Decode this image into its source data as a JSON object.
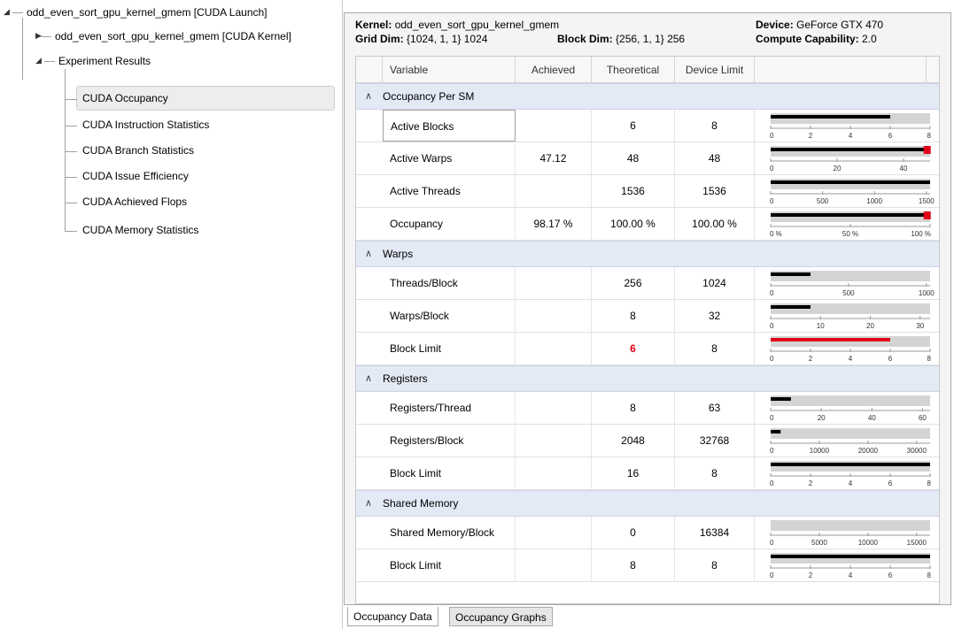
{
  "tree": {
    "root": "odd_even_sort_gpu_kernel_gmem [CUDA Launch]",
    "kernel_node": "odd_even_sort_gpu_kernel_gmem [CUDA Kernel]",
    "results_node": "Experiment Results",
    "children": [
      "CUDA Occupancy",
      "CUDA Instruction Statistics",
      "CUDA Branch Statistics",
      "CUDA Issue Efficiency",
      "CUDA Achieved Flops",
      "CUDA Memory Statistics"
    ],
    "selected": "CUDA Occupancy"
  },
  "header": {
    "kernel_label": "Kernel:",
    "kernel_value": "odd_even_sort_gpu_kernel_gmem",
    "grid_label": "Grid Dim:",
    "grid_value": "{1024, 1, 1} 1024",
    "block_label": "Block Dim:",
    "block_value": "{256, 1, 1} 256",
    "device_label": "Device:",
    "device_value": "GeForce GTX 470",
    "cc_label": "Compute Capability:",
    "cc_value": "2.0"
  },
  "columns": [
    "Variable",
    "Achieved",
    "Theoretical",
    "Device Limit"
  ],
  "sections": [
    {
      "title": "Occupancy Per SM",
      "rows": [
        {
          "name": "Active Blocks",
          "achieved": "",
          "theoretical": "6",
          "limit": "8",
          "bar": {
            "max": 8,
            "value": 6,
            "ticks": [
              "0",
              "2",
              "4",
              "6",
              "8"
            ],
            "tickvals": [
              0,
              2,
              4,
              6,
              8
            ],
            "marker": null,
            "color": "#000000"
          }
        },
        {
          "name": "Active Warps",
          "achieved": "47.12",
          "theoretical": "48",
          "limit": "48",
          "bar": {
            "max": 48,
            "value": 48,
            "ticks": [
              "0",
              "20",
              "40"
            ],
            "tickvals": [
              0,
              20,
              40
            ],
            "marker": 47.12,
            "color": "#000000"
          }
        },
        {
          "name": "Active Threads",
          "achieved": "",
          "theoretical": "1536",
          "limit": "1536",
          "bar": {
            "max": 1536,
            "value": 1536,
            "ticks": [
              "0",
              "500",
              "1000",
              "1500"
            ],
            "tickvals": [
              0,
              500,
              1000,
              1500
            ],
            "marker": null,
            "color": "#000000"
          }
        },
        {
          "name": "Occupancy",
          "achieved": "98.17 %",
          "theoretical": "100.00 %",
          "limit": "100.00 %",
          "bar": {
            "max": 100,
            "value": 100,
            "ticks": [
              "0 %",
              "50 %",
              "100 %"
            ],
            "tickvals": [
              0,
              50,
              100
            ],
            "marker": 98.17,
            "color": "#000000"
          }
        }
      ]
    },
    {
      "title": "Warps",
      "rows": [
        {
          "name": "Threads/Block",
          "achieved": "",
          "theoretical": "256",
          "limit": "1024",
          "bar": {
            "max": 1024,
            "value": 256,
            "ticks": [
              "0",
              "500",
              "1000"
            ],
            "tickvals": [
              0,
              500,
              1000
            ],
            "marker": null,
            "color": "#000000"
          }
        },
        {
          "name": "Warps/Block",
          "achieved": "",
          "theoretical": "8",
          "limit": "32",
          "bar": {
            "max": 32,
            "value": 8,
            "ticks": [
              "0",
              "10",
              "20",
              "30"
            ],
            "tickvals": [
              0,
              10,
              20,
              30
            ],
            "marker": null,
            "color": "#000000"
          }
        },
        {
          "name": "Block Limit",
          "achieved": "",
          "theoretical": "6",
          "limit": "8",
          "theoretical_highlight": true,
          "bar": {
            "max": 8,
            "value": 6,
            "ticks": [
              "0",
              "2",
              "4",
              "6",
              "8"
            ],
            "tickvals": [
              0,
              2,
              4,
              6,
              8
            ],
            "marker": null,
            "color": "#e0001a"
          }
        }
      ]
    },
    {
      "title": "Registers",
      "rows": [
        {
          "name": "Registers/Thread",
          "achieved": "",
          "theoretical": "8",
          "limit": "63",
          "bar": {
            "max": 63,
            "value": 8,
            "ticks": [
              "0",
              "20",
              "40",
              "60"
            ],
            "tickvals": [
              0,
              20,
              40,
              60
            ],
            "marker": null,
            "color": "#000000"
          }
        },
        {
          "name": "Registers/Block",
          "achieved": "",
          "theoretical": "2048",
          "limit": "32768",
          "bar": {
            "max": 32768,
            "value": 2048,
            "ticks": [
              "0",
              "10000",
              "20000",
              "30000"
            ],
            "tickvals": [
              0,
              10000,
              20000,
              30000
            ],
            "marker": null,
            "color": "#000000"
          }
        },
        {
          "name": "Block Limit",
          "achieved": "",
          "theoretical": "16",
          "limit": "8",
          "bar": {
            "max": 8,
            "value": 8,
            "ticks": [
              "0",
              "2",
              "4",
              "6",
              "8"
            ],
            "tickvals": [
              0,
              2,
              4,
              6,
              8
            ],
            "marker": null,
            "color": "#000000"
          }
        }
      ]
    },
    {
      "title": "Shared Memory",
      "rows": [
        {
          "name": "Shared Memory/Block",
          "achieved": "",
          "theoretical": "0",
          "limit": "16384",
          "bar": {
            "max": 16384,
            "value": 0,
            "ticks": [
              "0",
              "5000",
              "10000",
              "15000"
            ],
            "tickvals": [
              0,
              5000,
              10000,
              15000
            ],
            "marker": null,
            "color": "#000000"
          }
        },
        {
          "name": "Block Limit",
          "achieved": "",
          "theoretical": "8",
          "limit": "8",
          "bar": {
            "max": 8,
            "value": 8,
            "ticks": [
              "0",
              "2",
              "4",
              "6",
              "8"
            ],
            "tickvals": [
              0,
              2,
              4,
              6,
              8
            ],
            "marker": null,
            "color": "#000000"
          }
        }
      ]
    }
  ],
  "tabs": [
    "Occupancy Data",
    "Occupancy Graphs"
  ],
  "colors": {
    "accent_red": "#e0001a",
    "section_bg": "#e3e9f5",
    "bar_bg": "#d4d4d4"
  }
}
